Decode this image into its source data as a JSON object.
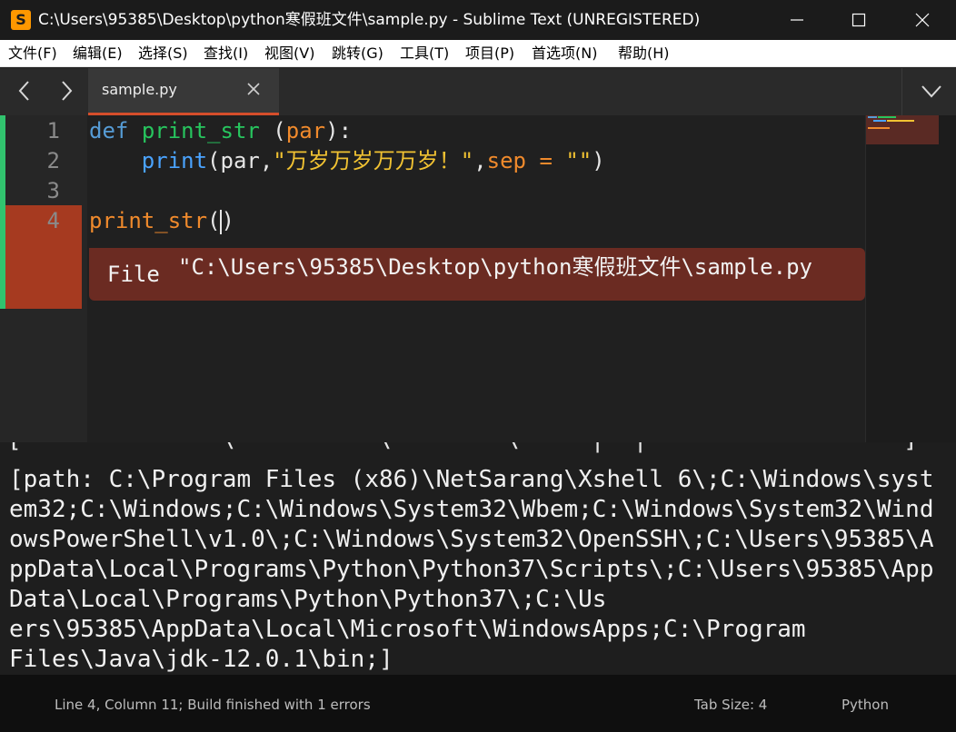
{
  "window": {
    "title": "C:\\Users\\95385\\Desktop\\python寒假班文件\\sample.py - Sublime Text (UNREGISTERED)",
    "app_icon": "sublime-logo-icon"
  },
  "menu": [
    "文件(F)",
    "编辑(E)",
    "选择(S)",
    "查找(I)",
    "视图(V)",
    "跳转(G)",
    "工具(T)",
    "项目(P)",
    "首选项(N)",
    "帮助(H)"
  ],
  "tabs": [
    {
      "label": "sample.py",
      "active": true
    }
  ],
  "editor": {
    "line_numbers": [
      "1",
      "2",
      "3",
      "4"
    ],
    "code": {
      "l1_def": "def",
      "l1_fn": "print_str",
      "l1_open": " (",
      "l1_param": "par",
      "l1_close": "):",
      "l2_indent": "    ",
      "l2_print": "print",
      "l2_a": "(par,",
      "l2_str": "\"万岁万岁万万岁！\"",
      "l2_b": ",",
      "l2_sep": "sep = ",
      "l2_str2": "\"\"",
      "l2_c": ")",
      "l4_call": "print_str",
      "l4_open": "(",
      "l4_close": ")"
    },
    "error": {
      "prefix": "File",
      "path": "\"C:\\Users\\95385\\Desktop\\python寒假班文件\\sample.py"
    },
    "colors": {
      "error_bg": "#6b2b22",
      "gutter_modified": "#31c36e",
      "tab_accent": "#d54e2b"
    }
  },
  "output": {
    "lines": [
      "[path: C:\\Program Files (x86)\\NetSarang\\Xshell 6\\;C:\\Windows\\syst",
      "em32;C:\\Windows;C:\\Windows\\System32\\Wbem;C:\\Windows\\System32\\Wind",
      "owsPowerShell\\v1.0\\;C:\\Windows\\System32\\OpenSSH\\;C:\\Users\\95385\\A",
      "ppData\\Local\\Programs\\Python\\Python37\\Scripts\\;C:\\Users\\95385\\App",
      "Data\\Local\\Programs\\Python\\Python37\\;C:\\Us",
      "ers\\95385\\AppData\\Local\\Microsoft\\WindowsApps;C:\\Program",
      "Files\\Java\\jdk-12.0.1\\bin;]"
    ],
    "cut_line": "[              \\          \\        \\     |  |                  ]"
  },
  "status": {
    "position": "Line 4, Column 11; Build finished with 1 errors",
    "tab_size": "Tab Size: 4",
    "syntax": "Python"
  }
}
